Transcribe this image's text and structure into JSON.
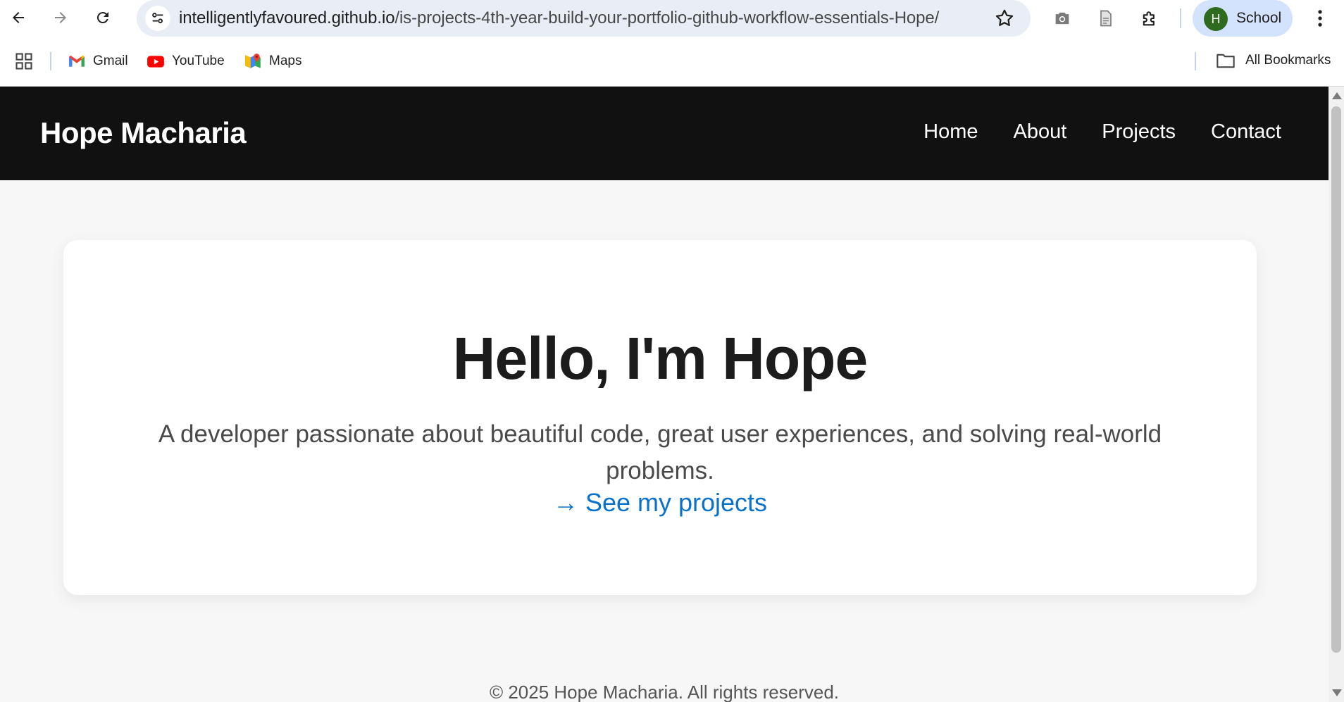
{
  "browser": {
    "url_host": "intelligentlyfavoured.github.io",
    "url_path": "/is-projects-4th-year-build-your-portfolio-github-workflow-essentials-Hope/",
    "profile_initial": "H",
    "profile_name": "School",
    "bookmarks": [
      {
        "label": "Gmail",
        "icon": "gmail-icon"
      },
      {
        "label": "YouTube",
        "icon": "youtube-icon"
      },
      {
        "label": "Maps",
        "icon": "maps-icon"
      }
    ],
    "all_bookmarks_label": "All Bookmarks"
  },
  "site": {
    "brand": "Hope Macharia",
    "nav": [
      "Home",
      "About",
      "Projects",
      "Contact"
    ]
  },
  "hero": {
    "title": "Hello, I'm Hope",
    "subtitle": "A developer passionate about beautiful code, great user experiences, and solving real-world problems.",
    "link": "→ See my projects"
  },
  "footer": {
    "text": "© 2025 Hope Macharia. All rights reserved."
  },
  "colors": {
    "header_bg": "#111111",
    "link": "#0a72c8",
    "page_bg": "#f7f7f7"
  }
}
